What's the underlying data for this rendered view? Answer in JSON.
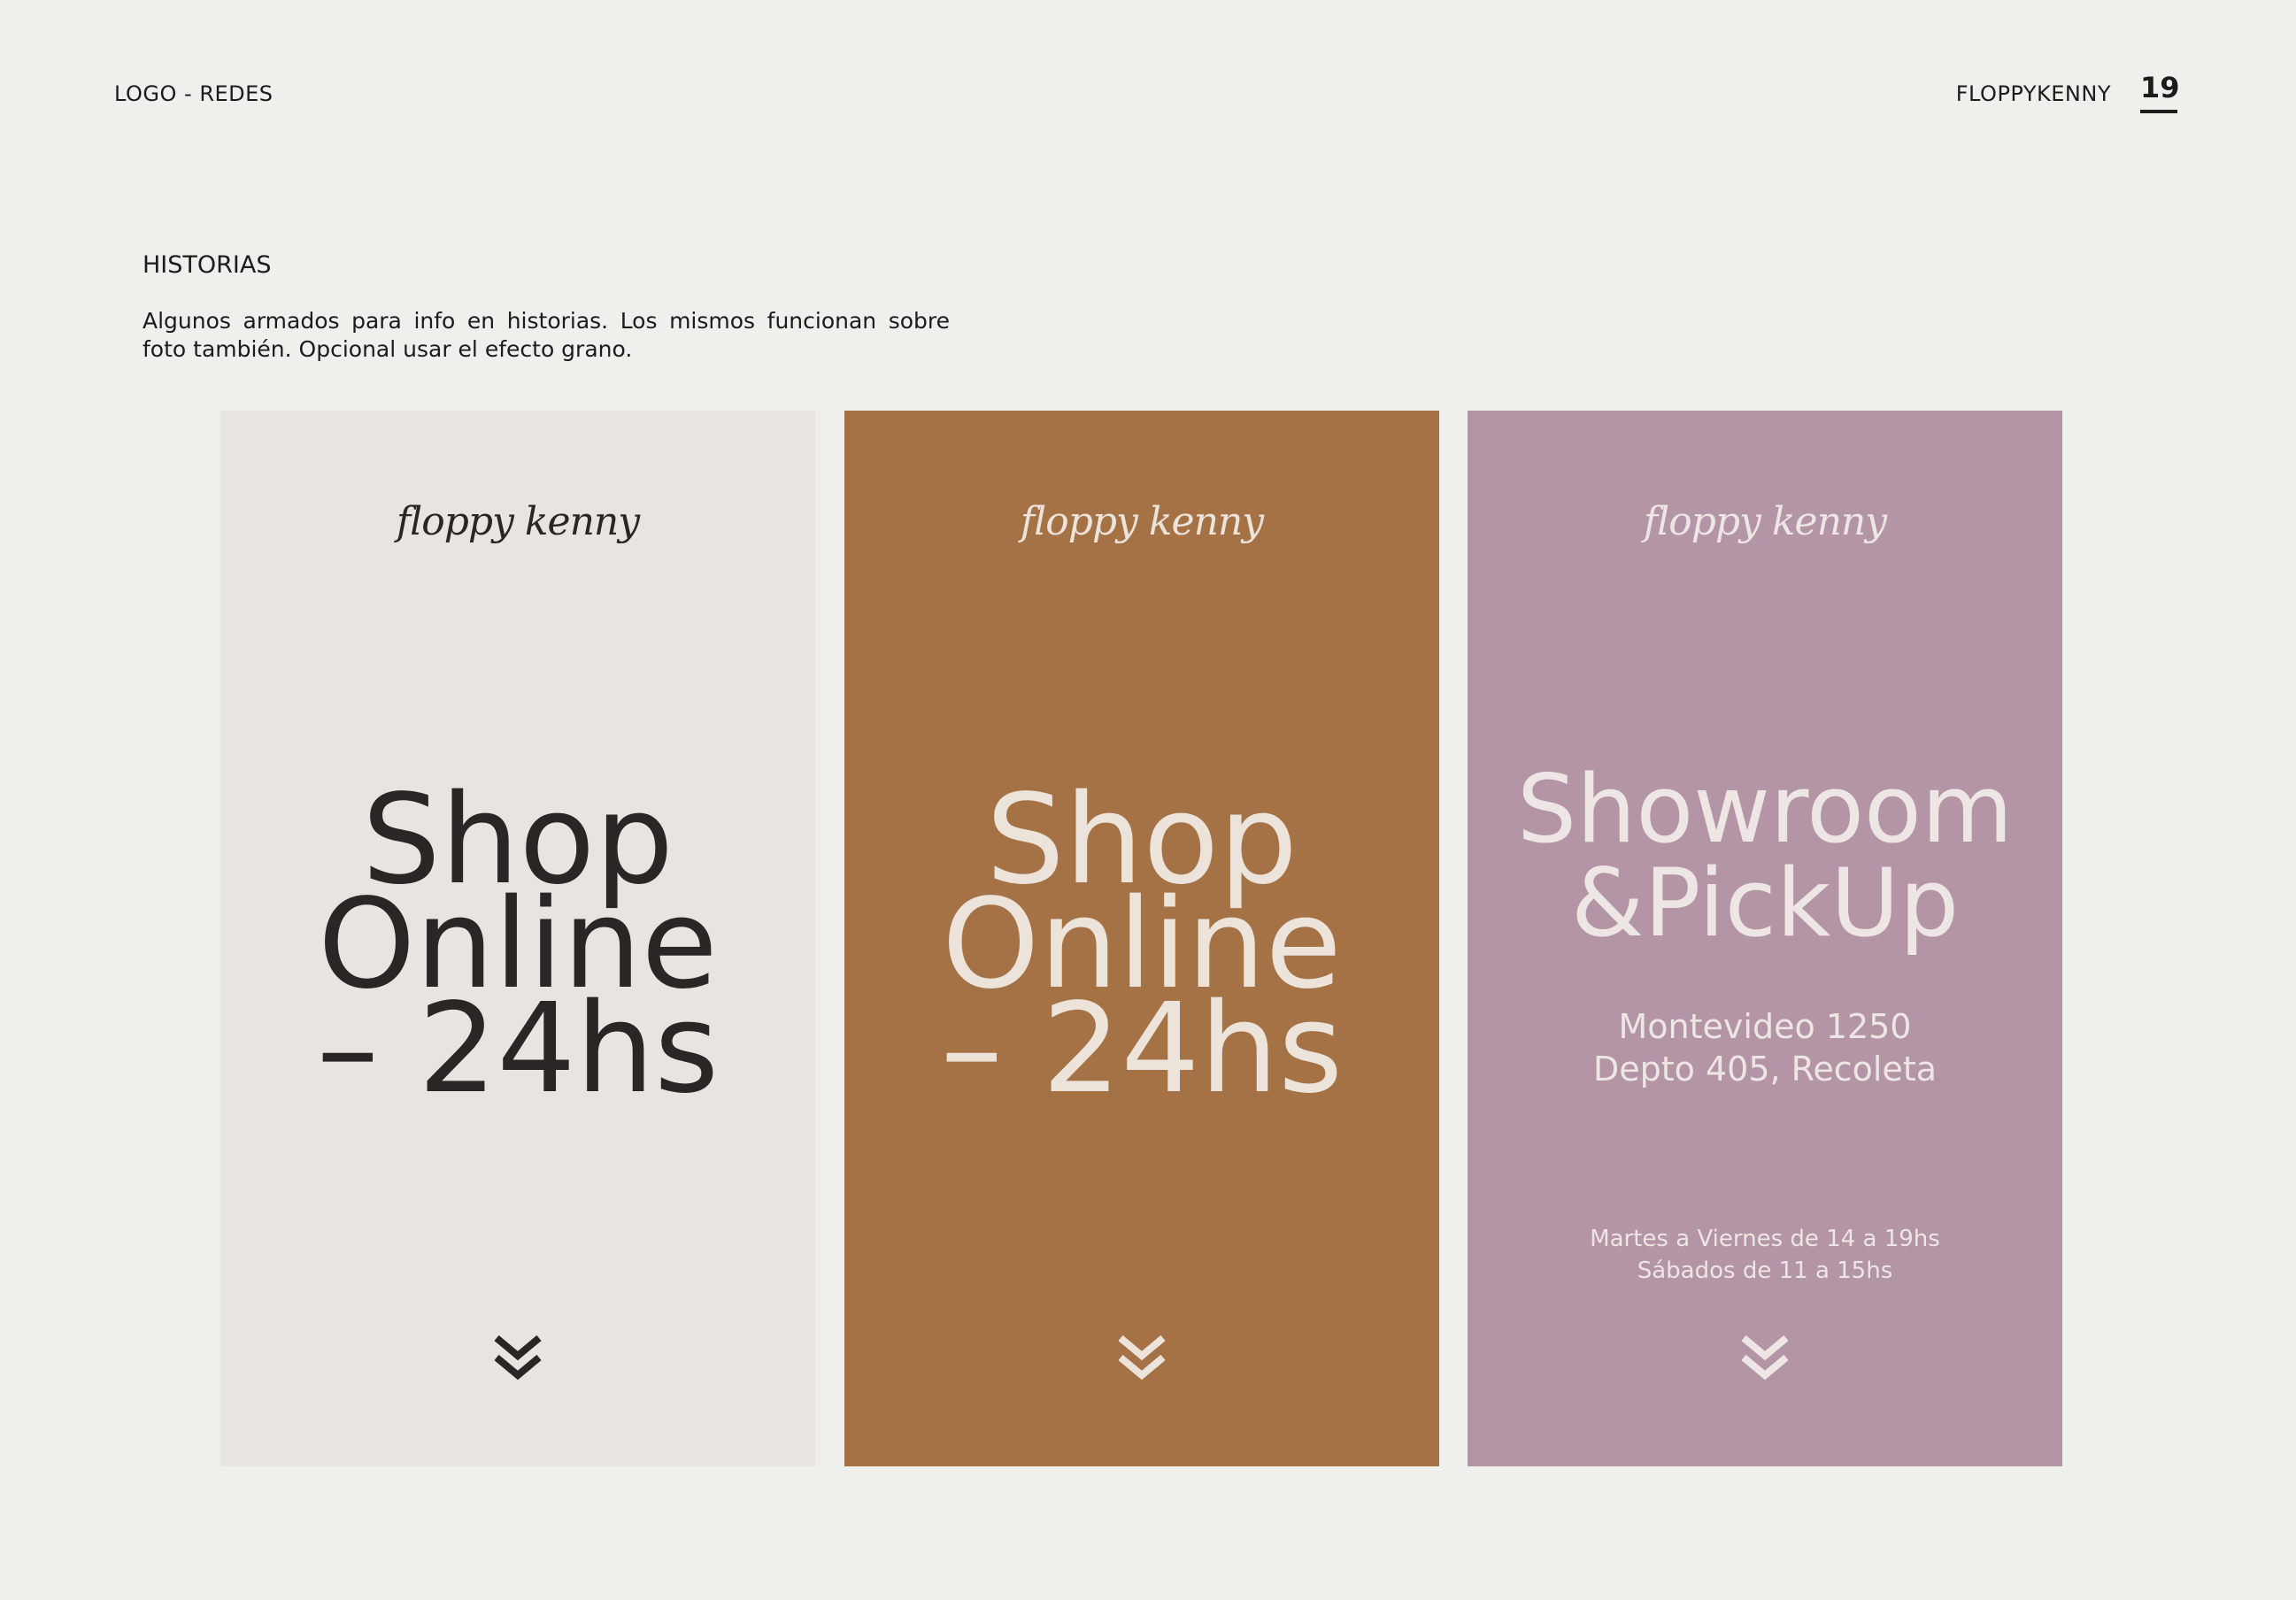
{
  "header": {
    "section_label": "LOGO - REDES",
    "brand": "FLOPPYKENNY",
    "page_number": "19"
  },
  "section": {
    "title": "HISTORIAS",
    "description": "Algunos armados para info en historias. Los mismos funcionan sobre foto también. Opcional usar el efecto grano."
  },
  "cards": [
    {
      "logo": "floppy kenny",
      "headline_lines": [
        "Shop",
        "Online",
        "– 24hs"
      ],
      "background": "#e8e4e0",
      "text_color": "#2a2626",
      "icon": "double-chevron-down-icon"
    },
    {
      "logo": "floppy kenny",
      "headline_lines": [
        "Shop",
        "Online",
        "– 24hs"
      ],
      "background": "#a47245",
      "text_color": "#ece3db",
      "icon": "double-chevron-down-icon"
    },
    {
      "logo": "floppy kenny",
      "headline_lines": [
        "Showroom",
        "&PickUp"
      ],
      "address_lines": [
        "Montevideo 1250",
        "Depto 405, Recoleta"
      ],
      "hours_lines": [
        "Martes a Viernes de 14 a 19hs",
        "Sábados de 11 a 15hs"
      ],
      "background": "#b395a5",
      "text_color": "#eee6e4",
      "icon": "double-chevron-down-icon"
    }
  ]
}
